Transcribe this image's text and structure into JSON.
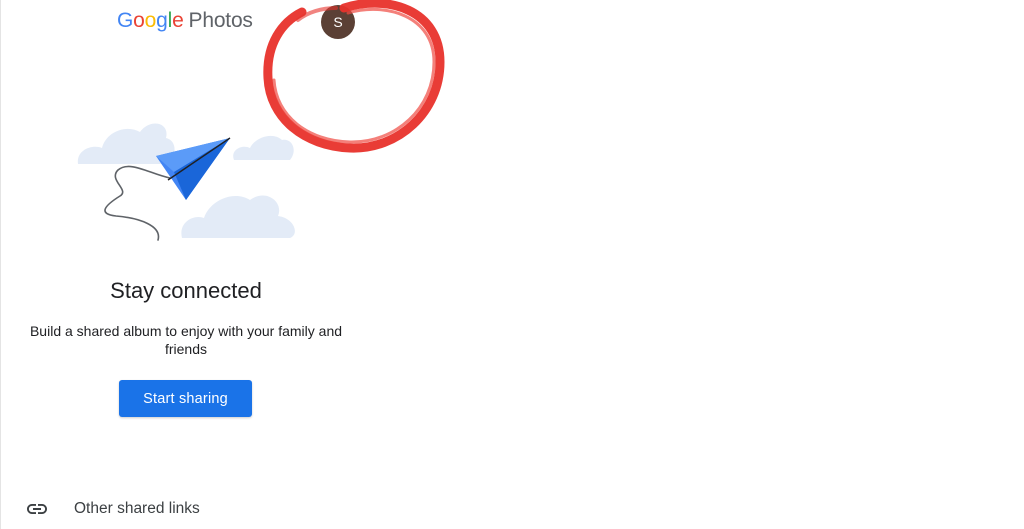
{
  "header": {
    "logo": {
      "letters": [
        {
          "char": "G",
          "color": "#4285F4"
        },
        {
          "char": "o",
          "color": "#EA4335"
        },
        {
          "char": "o",
          "color": "#FBBC05"
        },
        {
          "char": "g",
          "color": "#4285F4"
        },
        {
          "char": "l",
          "color": "#34A853"
        },
        {
          "char": "e",
          "color": "#EA4335"
        }
      ],
      "product": "Photos"
    },
    "avatar_initial": "S",
    "avatar_color": "#5b4035"
  },
  "annotation": {
    "circle_color": "#e8322b"
  },
  "empty_state": {
    "illustration": "paper-plane-with-clouds",
    "title": "Stay connected",
    "description": "Build a shared album to enjoy with your family and friends",
    "cta_label": "Start sharing",
    "cta_color": "#1a73e8"
  },
  "footer_link": {
    "icon": "link-icon",
    "label": "Other shared links"
  }
}
